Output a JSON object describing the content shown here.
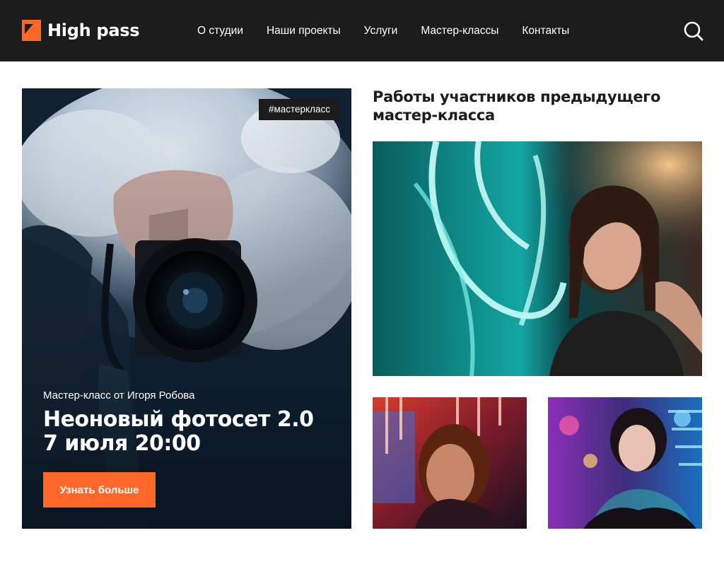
{
  "header": {
    "logo_text": "High pass",
    "nav": [
      {
        "label": "О студии"
      },
      {
        "label": "Наши проекты"
      },
      {
        "label": "Услуги"
      },
      {
        "label": "Мастер-классы"
      },
      {
        "label": "Контакты"
      }
    ],
    "search_icon": "search-icon"
  },
  "hero": {
    "tag": "#мастеркласс",
    "subtitle": "Мастер-класс от Игоря Робова",
    "title_line1": "Неоновый фотосет 2.0",
    "title_line2": "7 июля 20:00",
    "button_label": "Узнать больше"
  },
  "works": {
    "title_line1": "Работы участников предыдущего",
    "title_line2": "мастер-класса"
  },
  "colors": {
    "accent": "#ff6828",
    "header_bg": "#1c1c1c",
    "text": "#1c1c1c"
  }
}
